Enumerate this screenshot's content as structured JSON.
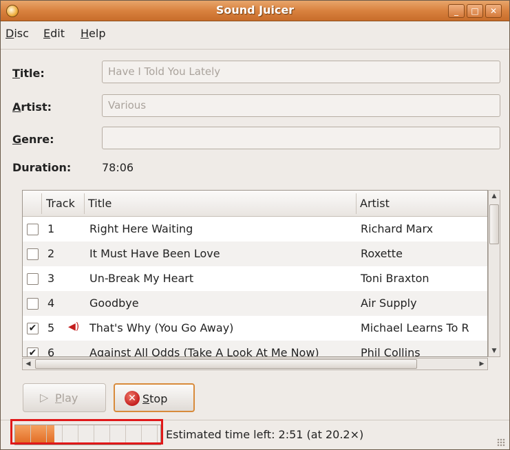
{
  "window": {
    "title": "Sound Juicer",
    "min_label": "_",
    "max_label": "□",
    "close_label": "✕"
  },
  "menu": [
    {
      "mnemonic": "D",
      "rest": "isc"
    },
    {
      "mnemonic": "E",
      "rest": "dit"
    },
    {
      "mnemonic": "H",
      "rest": "elp"
    }
  ],
  "form": {
    "title_label_m": "T",
    "title_label_rest": "itle:",
    "title_value": "Have I Told You Lately",
    "artist_label_m": "A",
    "artist_label_rest": "rtist:",
    "artist_value": "Various",
    "genre_label_m": "G",
    "genre_label_rest": "enre:",
    "genre_value": "",
    "duration_label": "Duration:",
    "duration_value": "78:06"
  },
  "tracklist": {
    "headers": {
      "track": "Track",
      "title": "Title",
      "artist": "Artist"
    },
    "rows": [
      {
        "checked": false,
        "num": "1",
        "title": "Right Here Waiting",
        "artist": "Richard Marx"
      },
      {
        "checked": false,
        "num": "2",
        "title": "It Must Have Been Love",
        "artist": "Roxette"
      },
      {
        "checked": false,
        "num": "3",
        "title": "Un-Break My Heart",
        "artist": "Toni Braxton"
      },
      {
        "checked": false,
        "num": "4",
        "title": "Goodbye",
        "artist": "Air Supply"
      },
      {
        "checked": true,
        "num": "5",
        "title": "That's Why (You Go Away)",
        "artist": "Michael Learns To R",
        "playing": true
      },
      {
        "checked": true,
        "num": "6",
        "title": "Against All Odds (Take A Look At Me Now)",
        "artist": "Phil Collins"
      }
    ]
  },
  "buttons": {
    "play_m": "P",
    "play_rest": "lay",
    "stop_m": "S",
    "stop_rest": "top"
  },
  "status": {
    "text": "Estimated time left: 2:51 (at 20.2×)",
    "progress_fraction": 0.27
  },
  "icons": {
    "play": "play-icon",
    "stop": "stop-icon",
    "speaker": "speaker-icon",
    "app": "sound-juicer-icon"
  },
  "colors": {
    "titlebar": "#d9823f",
    "progress": "#e06a20",
    "highlight": "#e01818"
  }
}
